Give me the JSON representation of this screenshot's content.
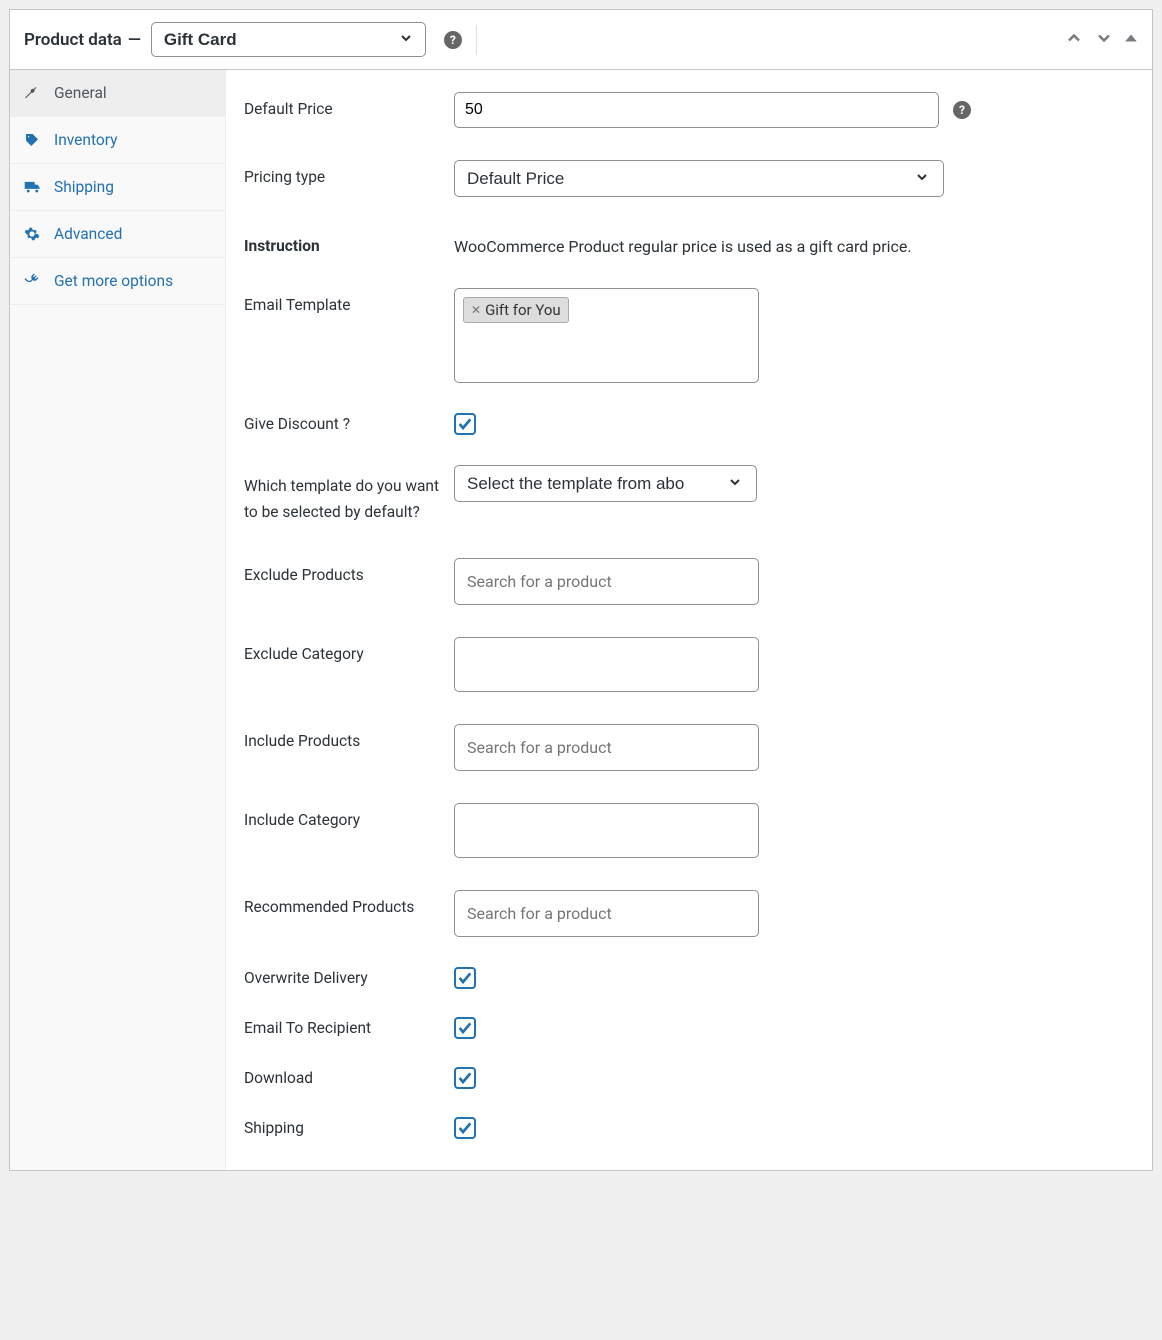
{
  "header": {
    "title": "Product data",
    "product_type": "Gift Card"
  },
  "tabs": [
    {
      "id": "general",
      "label": "General",
      "icon": "wrench",
      "active": true
    },
    {
      "id": "inventory",
      "label": "Inventory",
      "icon": "tag",
      "active": false
    },
    {
      "id": "shipping",
      "label": "Shipping",
      "icon": "truck",
      "active": false
    },
    {
      "id": "advanced",
      "label": "Advanced",
      "icon": "gear",
      "active": false
    },
    {
      "id": "more",
      "label": "Get more options",
      "icon": "plug",
      "active": false
    }
  ],
  "fields": {
    "default_price": {
      "label": "Default Price",
      "value": "50"
    },
    "pricing_type": {
      "label": "Pricing type",
      "value": "Default Price"
    },
    "instruction": {
      "label": "Instruction",
      "text": "WooCommerce Product regular price is used as a gift card price."
    },
    "email_template": {
      "label": "Email Template",
      "tag": "Gift for You"
    },
    "give_discount": {
      "label": "Give Discount ?",
      "checked": true
    },
    "default_template": {
      "label": "Which template do you want to be selected by default?",
      "value": "Select the template from abo"
    },
    "exclude_products": {
      "label": "Exclude Products",
      "placeholder": "Search for a product"
    },
    "exclude_category": {
      "label": "Exclude Category"
    },
    "include_products": {
      "label": "Include Products",
      "placeholder": "Search for a product"
    },
    "include_category": {
      "label": "Include Category"
    },
    "recommended_products": {
      "label": "Recommended Products",
      "placeholder": "Search for a product"
    },
    "overwrite_delivery": {
      "label": "Overwrite Delivery",
      "checked": true
    },
    "email_to_recipient": {
      "label": "Email To Recipient",
      "checked": true
    },
    "download": {
      "label": "Download",
      "checked": true
    },
    "shipping": {
      "label": "Shipping",
      "checked": true
    }
  }
}
